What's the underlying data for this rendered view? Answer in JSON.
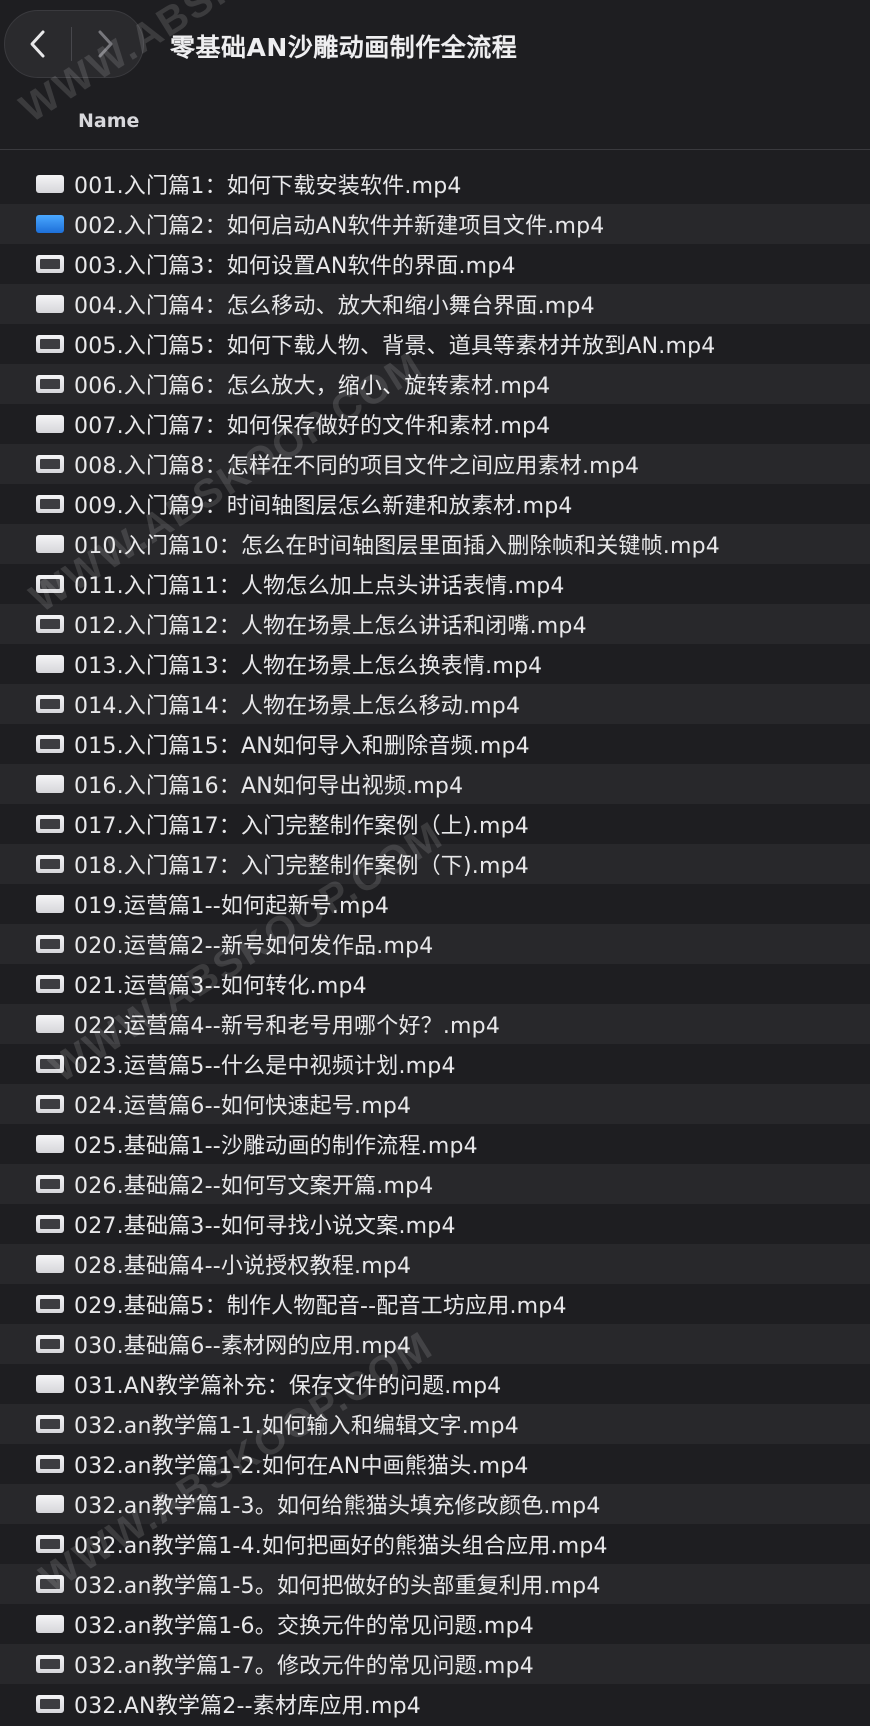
{
  "window": {
    "title": "零基础AN沙雕动画制作全流程"
  },
  "header": {
    "name_column": "Name"
  },
  "watermark": "WWW.ABSKOOP.COM",
  "files": [
    {
      "name": "001.入门篇1：如何下载安装软件.mp4",
      "icon": "video-file-icon"
    },
    {
      "name": "002.入门篇2：如何启动AN软件并新建项目文件.mp4",
      "icon": "video-file-blue-icon"
    },
    {
      "name": "003.入门篇3：如何设置AN软件的界面.mp4",
      "icon": "video-file-icon"
    },
    {
      "name": "004.入门篇4：怎么移动、放大和缩小舞台界面.mp4",
      "icon": "video-file-icon"
    },
    {
      "name": "005.入门篇5：如何下载人物、背景、道具等素材并放到AN.mp4",
      "icon": "video-file-icon"
    },
    {
      "name": "006.入门篇6：怎么放大，缩小、旋转素材.mp4",
      "icon": "video-file-icon"
    },
    {
      "name": "007.入门篇7：如何保存做好的文件和素材.mp4",
      "icon": "video-file-icon"
    },
    {
      "name": "008.入门篇8：怎样在不同的项目文件之间应用素材.mp4",
      "icon": "video-file-icon"
    },
    {
      "name": "009.入门篇9：时间轴图层怎么新建和放素材.mp4",
      "icon": "video-file-icon"
    },
    {
      "name": "010.入门篇10：怎么在时间轴图层里面插入删除帧和关键帧.mp4",
      "icon": "video-file-icon"
    },
    {
      "name": "011.入门篇11：人物怎么加上点头讲话表情.mp4",
      "icon": "video-file-icon"
    },
    {
      "name": "012.入门篇12：人物在场景上怎么讲话和闭嘴.mp4",
      "icon": "video-file-icon"
    },
    {
      "name": "013.入门篇13：人物在场景上怎么换表情.mp4",
      "icon": "video-file-icon"
    },
    {
      "name": "014.入门篇14：人物在场景上怎么移动.mp4",
      "icon": "video-file-icon"
    },
    {
      "name": "015.入门篇15：AN如何导入和删除音频.mp4",
      "icon": "video-file-icon"
    },
    {
      "name": "016.入门篇16：AN如何导出视频.mp4",
      "icon": "video-file-icon"
    },
    {
      "name": "017.入门篇17：入门完整制作案例（上).mp4",
      "icon": "video-file-icon"
    },
    {
      "name": "018.入门篇17：入门完整制作案例（下).mp4",
      "icon": "video-file-icon"
    },
    {
      "name": "019.运营篇1--如何起新号.mp4",
      "icon": "video-file-icon"
    },
    {
      "name": "020.运营篇2--新号如何发作品.mp4",
      "icon": "video-file-icon"
    },
    {
      "name": "021.运营篇3--如何转化.mp4",
      "icon": "video-file-icon"
    },
    {
      "name": "022.运营篇4--新号和老号用哪个好？.mp4",
      "icon": "video-file-icon"
    },
    {
      "name": "023.运营篇5--什么是中视频计划.mp4",
      "icon": "video-file-icon"
    },
    {
      "name": "024.运营篇6--如何快速起号.mp4",
      "icon": "video-file-icon"
    },
    {
      "name": "025.基础篇1--沙雕动画的制作流程.mp4",
      "icon": "video-file-icon"
    },
    {
      "name": "026.基础篇2--如何写文案开篇.mp4",
      "icon": "video-file-icon"
    },
    {
      "name": "027.基础篇3--如何寻找小说文案.mp4",
      "icon": "video-file-icon"
    },
    {
      "name": "028.基础篇4--小说授权教程.mp4",
      "icon": "video-file-icon"
    },
    {
      "name": "029.基础篇5：制作人物配音--配音工坊应用.mp4",
      "icon": "video-file-icon"
    },
    {
      "name": "030.基础篇6--素材网的应用.mp4",
      "icon": "video-file-icon"
    },
    {
      "name": "031.AN教学篇补充：保存文件的问题.mp4",
      "icon": "video-file-icon"
    },
    {
      "name": "032.an教学篇1-1.如何输入和编辑文字.mp4",
      "icon": "video-file-icon"
    },
    {
      "name": "032.an教学篇1-2.如何在AN中画熊猫头.mp4",
      "icon": "video-file-icon"
    },
    {
      "name": "032.an教学篇1-3。如何给熊猫头填充修改颜色.mp4",
      "icon": "video-file-icon"
    },
    {
      "name": "032.an教学篇1-4.如何把画好的熊猫头组合应用.mp4",
      "icon": "video-file-icon"
    },
    {
      "name": "032.an教学篇1-5。如何把做好的头部重复利用.mp4",
      "icon": "video-file-icon"
    },
    {
      "name": "032.an教学篇1-6。交换元件的常见问题.mp4",
      "icon": "video-file-icon"
    },
    {
      "name": "032.an教学篇1-7。修改元件的常见问题.mp4",
      "icon": "video-file-icon"
    },
    {
      "name": "032.AN教学篇2--素材库应用.mp4",
      "icon": "video-file-icon"
    }
  ]
}
